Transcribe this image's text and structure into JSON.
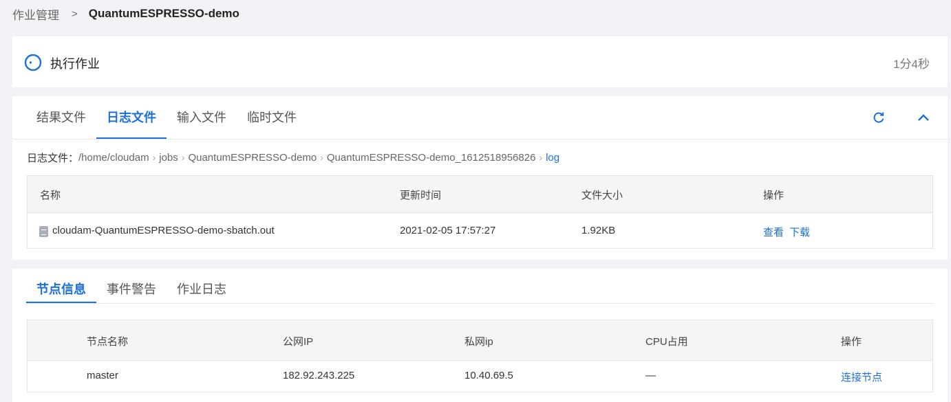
{
  "breadcrumb": {
    "parent": "作业管理",
    "separator": ">",
    "current": "QuantumESPRESSO-demo"
  },
  "status": {
    "text": "执行作业",
    "elapsed": "1分4秒"
  },
  "file_tabs": [
    {
      "label": "结果文件",
      "active": false
    },
    {
      "label": "日志文件",
      "active": true
    },
    {
      "label": "输入文件",
      "active": false
    },
    {
      "label": "临时文件",
      "active": false
    }
  ],
  "path": {
    "label": "日志文件：",
    "segments": [
      "/home/cloudam",
      "jobs",
      "QuantumESPRESSO-demo",
      "QuantumESPRESSO-demo_1612518956826",
      "log"
    ]
  },
  "file_table": {
    "headers": [
      "名称",
      "更新时间",
      "文件大小",
      "操作"
    ],
    "rows": [
      {
        "name": "cloudam-QuantumESPRESSO-demo-sbatch.out",
        "updated": "2021-02-05 17:57:27",
        "size": "1.92KB",
        "actions": [
          "查看",
          "下载"
        ]
      }
    ]
  },
  "node_tabs": [
    {
      "label": "节点信息",
      "active": true
    },
    {
      "label": "事件警告",
      "active": false
    },
    {
      "label": "作业日志",
      "active": false
    }
  ],
  "node_table": {
    "headers": [
      "节点名称",
      "公网IP",
      "私网ip",
      "CPU占用",
      "操作"
    ],
    "rows": [
      {
        "name": "master",
        "public_ip": "182.92.243.225",
        "private_ip": "10.40.69.5",
        "cpu": "—",
        "action": "连接节点"
      }
    ]
  },
  "icons": {
    "status": "loading-circle-icon",
    "refresh": "refresh-icon",
    "collapse": "chevron-up-icon",
    "file": "file-icon"
  },
  "colors": {
    "accent": "#1a6fdc",
    "background": "#f0f2f5"
  }
}
